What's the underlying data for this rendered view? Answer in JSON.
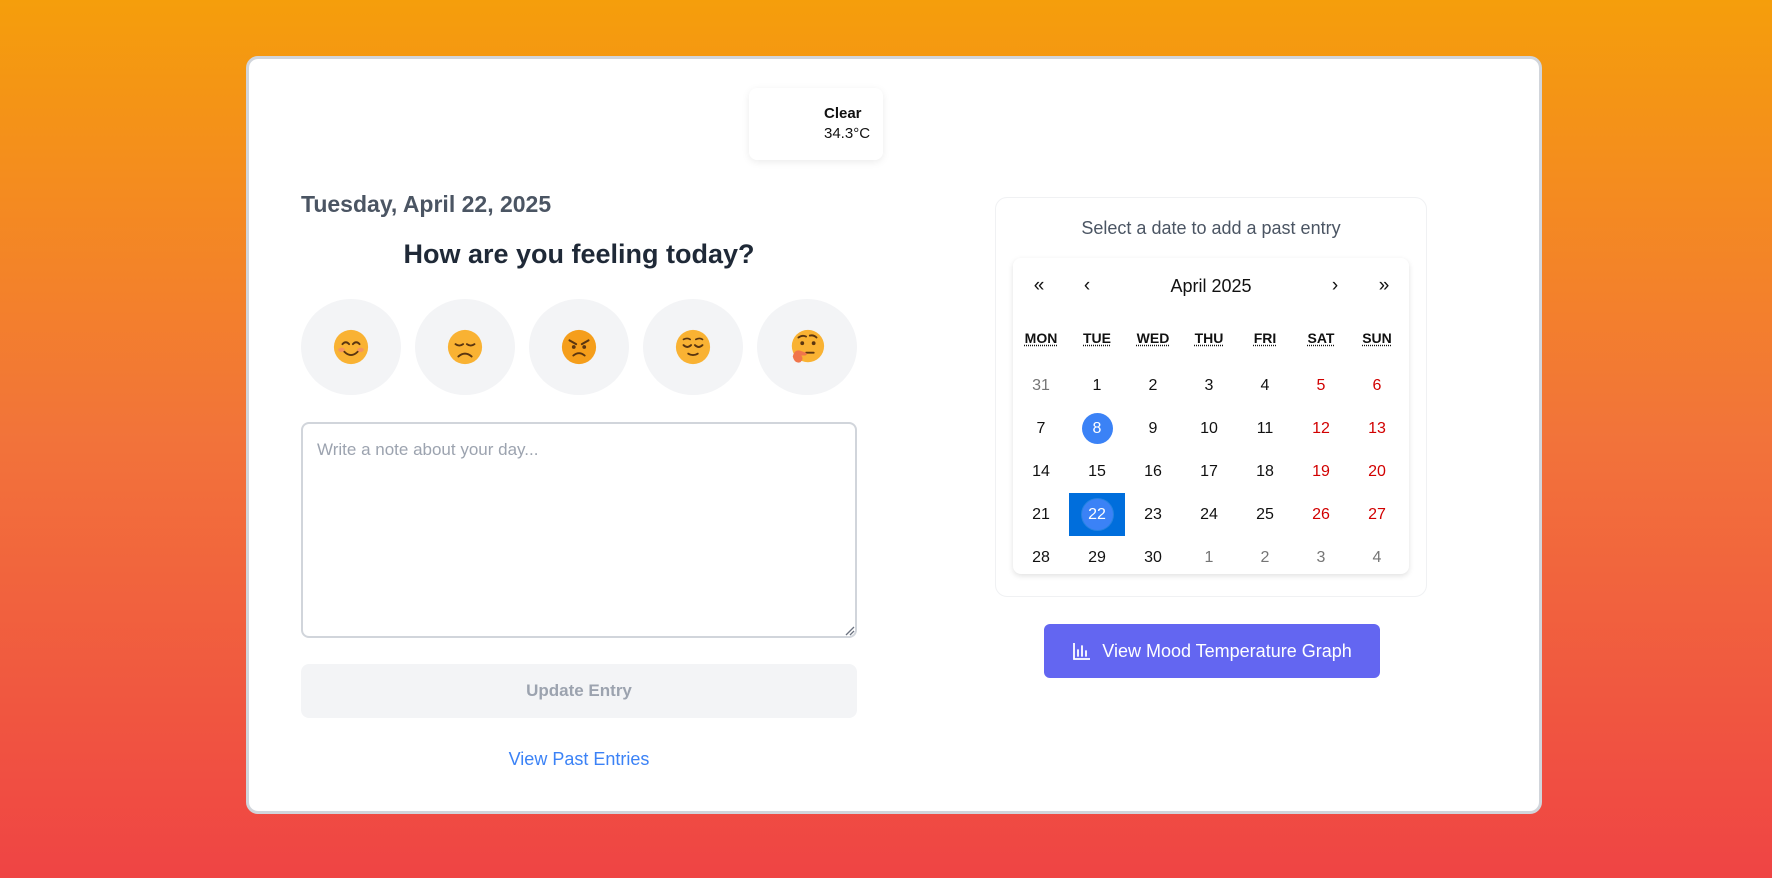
{
  "weather": {
    "condition": "Clear",
    "temperature": "34.3°C",
    "icon": "moon-icon"
  },
  "entry": {
    "date_heading": "Tuesday, April 22, 2025",
    "question": "How are you feeling today?",
    "moods": [
      {
        "name": "happy",
        "icon": "smiling-face-icon"
      },
      {
        "name": "sad",
        "icon": "disappointed-face-icon"
      },
      {
        "name": "angry",
        "icon": "angry-face-icon"
      },
      {
        "name": "relieved",
        "icon": "relieved-face-icon"
      },
      {
        "name": "thinking",
        "icon": "thinking-face-icon"
      }
    ],
    "note_placeholder": "Write a note about your day...",
    "note_value": "",
    "update_label": "Update Entry",
    "past_entries_label": "View Past Entries"
  },
  "calendar": {
    "title": "Select a date to add a past entry",
    "nav": {
      "prev_year": "«",
      "prev_month": "‹",
      "label": "April 2025",
      "next_month": "›",
      "next_year": "»"
    },
    "weekdays": [
      "MON",
      "TUE",
      "WED",
      "THU",
      "FRI",
      "SAT",
      "SUN"
    ],
    "weeks": [
      [
        "31",
        "1",
        "2",
        "3",
        "4",
        "5",
        "6"
      ],
      [
        "7",
        "8",
        "9",
        "10",
        "11",
        "12",
        "13"
      ],
      [
        "14",
        "15",
        "16",
        "17",
        "18",
        "19",
        "20"
      ],
      [
        "21",
        "22",
        "23",
        "24",
        "25",
        "26",
        "27"
      ],
      [
        "28",
        "29",
        "30",
        "1",
        "2",
        "3",
        "4"
      ]
    ],
    "today": "22",
    "marked": [
      "8"
    ],
    "colors": {
      "weekend": "#d10000",
      "neighbor": "#757575",
      "today_bg": "#006edc",
      "marked": "#3b82f6"
    }
  },
  "graph_button": {
    "label": "View Mood Temperature Graph",
    "icon": "bar-chart-icon"
  }
}
